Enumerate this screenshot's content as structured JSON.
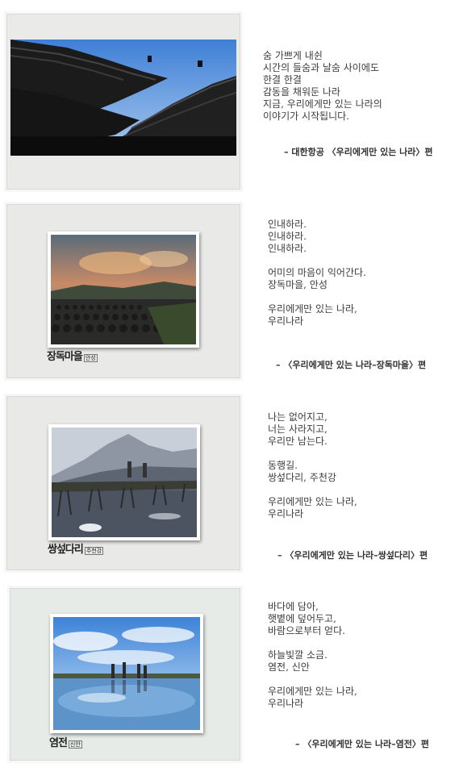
{
  "sections": [
    {
      "poem": "숨 가쁘게 내쉰\n시간의 들숨과 날숨 사이에도\n한결 한결\n감동을 채워둔 나라\n지금, 우리에게만 있는 나라의\n이야기가 시작됩니다.",
      "credit": "– 대한항공 〈우리에게만 있는 나라〉편",
      "photo": "traditional-roof"
    },
    {
      "poem": "인내하라.\n인내하라.\n인내하라.\n\n어미의 마음이 익어간다.\n장독마을, 안성\n\n우리에게만 있는 나라,\n우리나라",
      "credit": "– 〈우리에게만 있는 나라–장독마을〉편",
      "caption_main": "장독마을",
      "caption_sub": "안성",
      "photo": "jar-village"
    },
    {
      "poem": "나는 없어지고,\n너는 사라지고,\n우리만 남는다.\n\n동행길.\n쌍섶다리, 주천강\n\n우리에게만 있는 나라,\n우리나라",
      "credit": "– 〈우리에게만 있는 나라–쌍섶다리〉편",
      "caption_main": "쌍섶다리",
      "caption_sub": "주천강",
      "photo": "log-bridge"
    },
    {
      "poem": "바다에 담아,\n햇볕에 덮어두고,\n바람으로부터 얻다.\n\n하늘빛깔 소금.\n염전, 신안\n\n우리에게만 있는 나라,\n우리나라",
      "credit": "– 〈우리에게만 있는 나라–염전〉편",
      "caption_main": "염전",
      "caption_sub": "신안",
      "photo": "salt-field"
    }
  ]
}
